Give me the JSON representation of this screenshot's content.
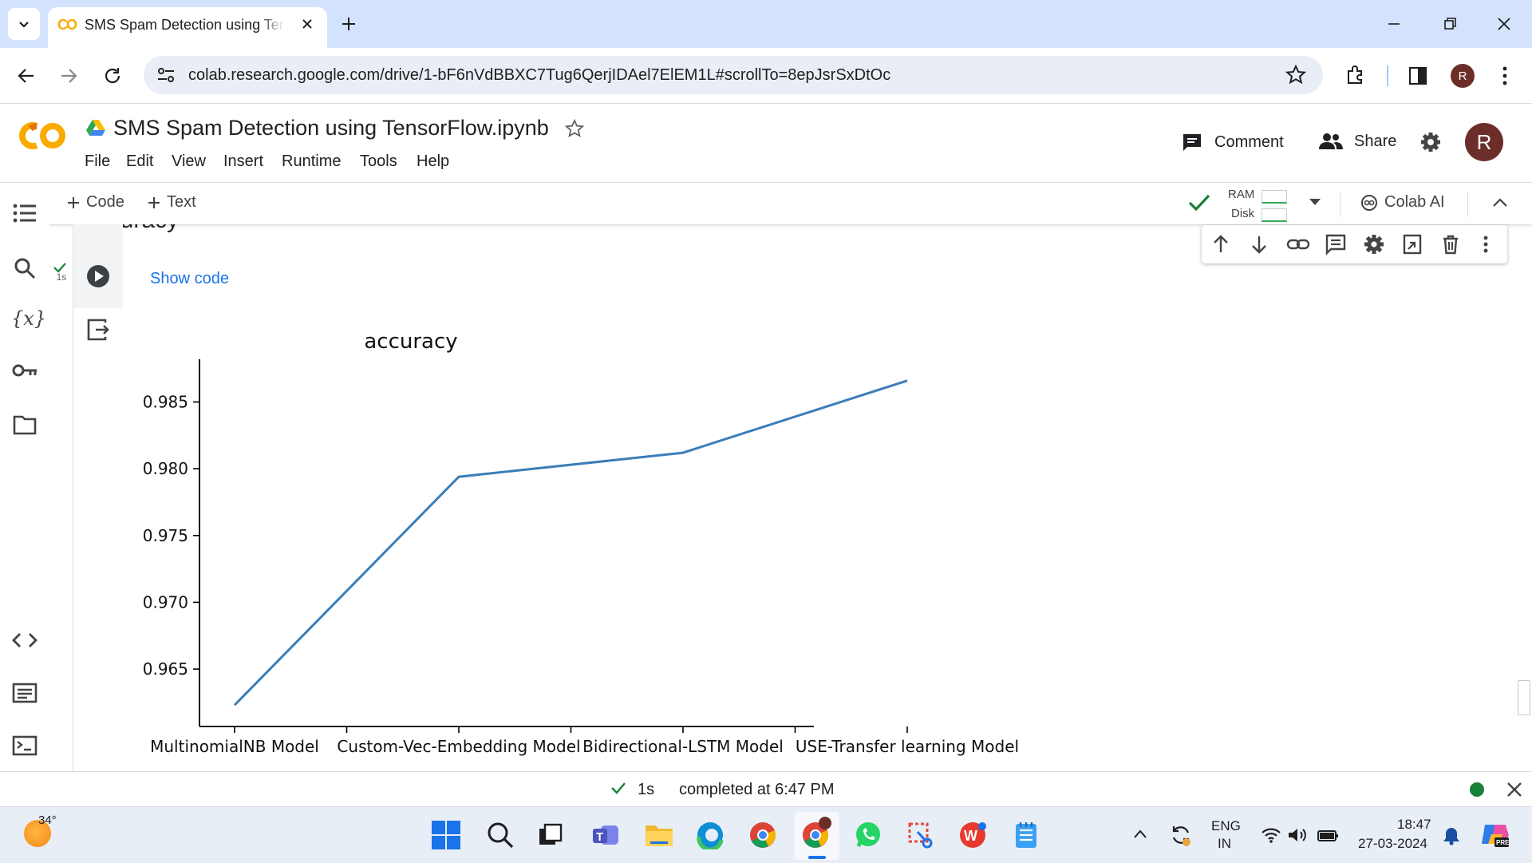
{
  "browser": {
    "tab_title": "SMS Spam Detection using TensorFlow.ipynb",
    "url": "colab.research.google.com/drive/1-bF6nVdBBXC7Tug6QerjIDAel7ElEM1L#scrollTo=8epJsrSxDtOc",
    "profile_initial": "R"
  },
  "colab": {
    "logo": "CO",
    "notebook_title": "SMS Spam Detection using TensorFlow.ipynb",
    "menu": [
      "File",
      "Edit",
      "View",
      "Insert",
      "Runtime",
      "Tools",
      "Help"
    ],
    "comment_label": "Comment",
    "share_label": "Share",
    "user_initial": "R",
    "add_code_label": "Code",
    "add_text_label": "Text",
    "ram_label": "RAM",
    "disk_label": "Disk",
    "colab_ai_label": "Colab AI",
    "section_heading_partial": "accuracy",
    "exec_time": "1s",
    "show_code_label": "Show code"
  },
  "chart_data": {
    "type": "line",
    "title": "accuracy",
    "categories": [
      "MultinomialNB Model",
      "Custom-Vec-Embedding Model",
      "Bidirectional-LSTM Model",
      "USE-Transfer learning Model"
    ],
    "series": [
      {
        "values": [
          0.9623,
          0.9794,
          0.9812,
          0.9866
        ]
      }
    ],
    "yticks": [
      0.965,
      0.97,
      0.975,
      0.98,
      0.985
    ],
    "ytick_labels": [
      "0.965",
      "0.970",
      "0.975",
      "0.980",
      "0.985"
    ],
    "ylim": [
      0.9607,
      0.9882
    ],
    "line_color": "#3a7eb8",
    "grid": false
  },
  "status": {
    "exec_time": "1s",
    "completion_text": "completed at 6:47 PM",
    "connection_color": "#188038"
  },
  "taskbar": {
    "weather_temp": "34°",
    "lang_top": "ENG",
    "lang_bottom": "IN",
    "time": "18:47",
    "date": "27-03-2024"
  }
}
